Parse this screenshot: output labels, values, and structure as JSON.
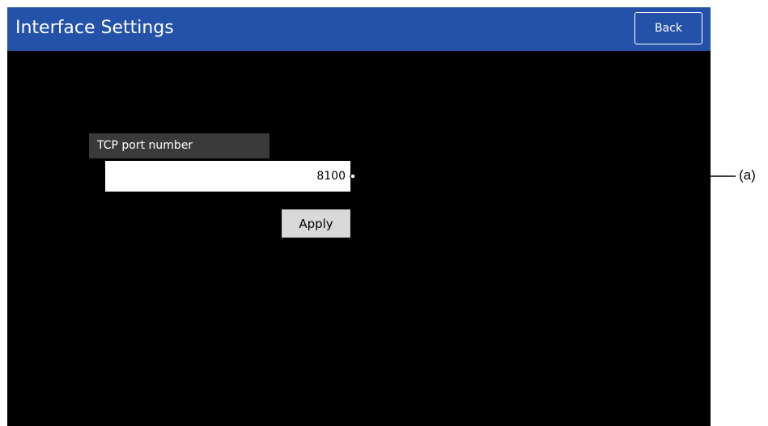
{
  "window": {
    "title": "Interface Settings",
    "back_label": "Back"
  },
  "tcp_port": {
    "label": "TCP port number",
    "value": "8100"
  },
  "apply_label": "Apply",
  "callout": {
    "label": "(a)"
  },
  "colors": {
    "titlebar": "#2352a8",
    "background": "#000000",
    "label_bg": "#3a3a3a",
    "button_bg": "#d9d9d9"
  }
}
